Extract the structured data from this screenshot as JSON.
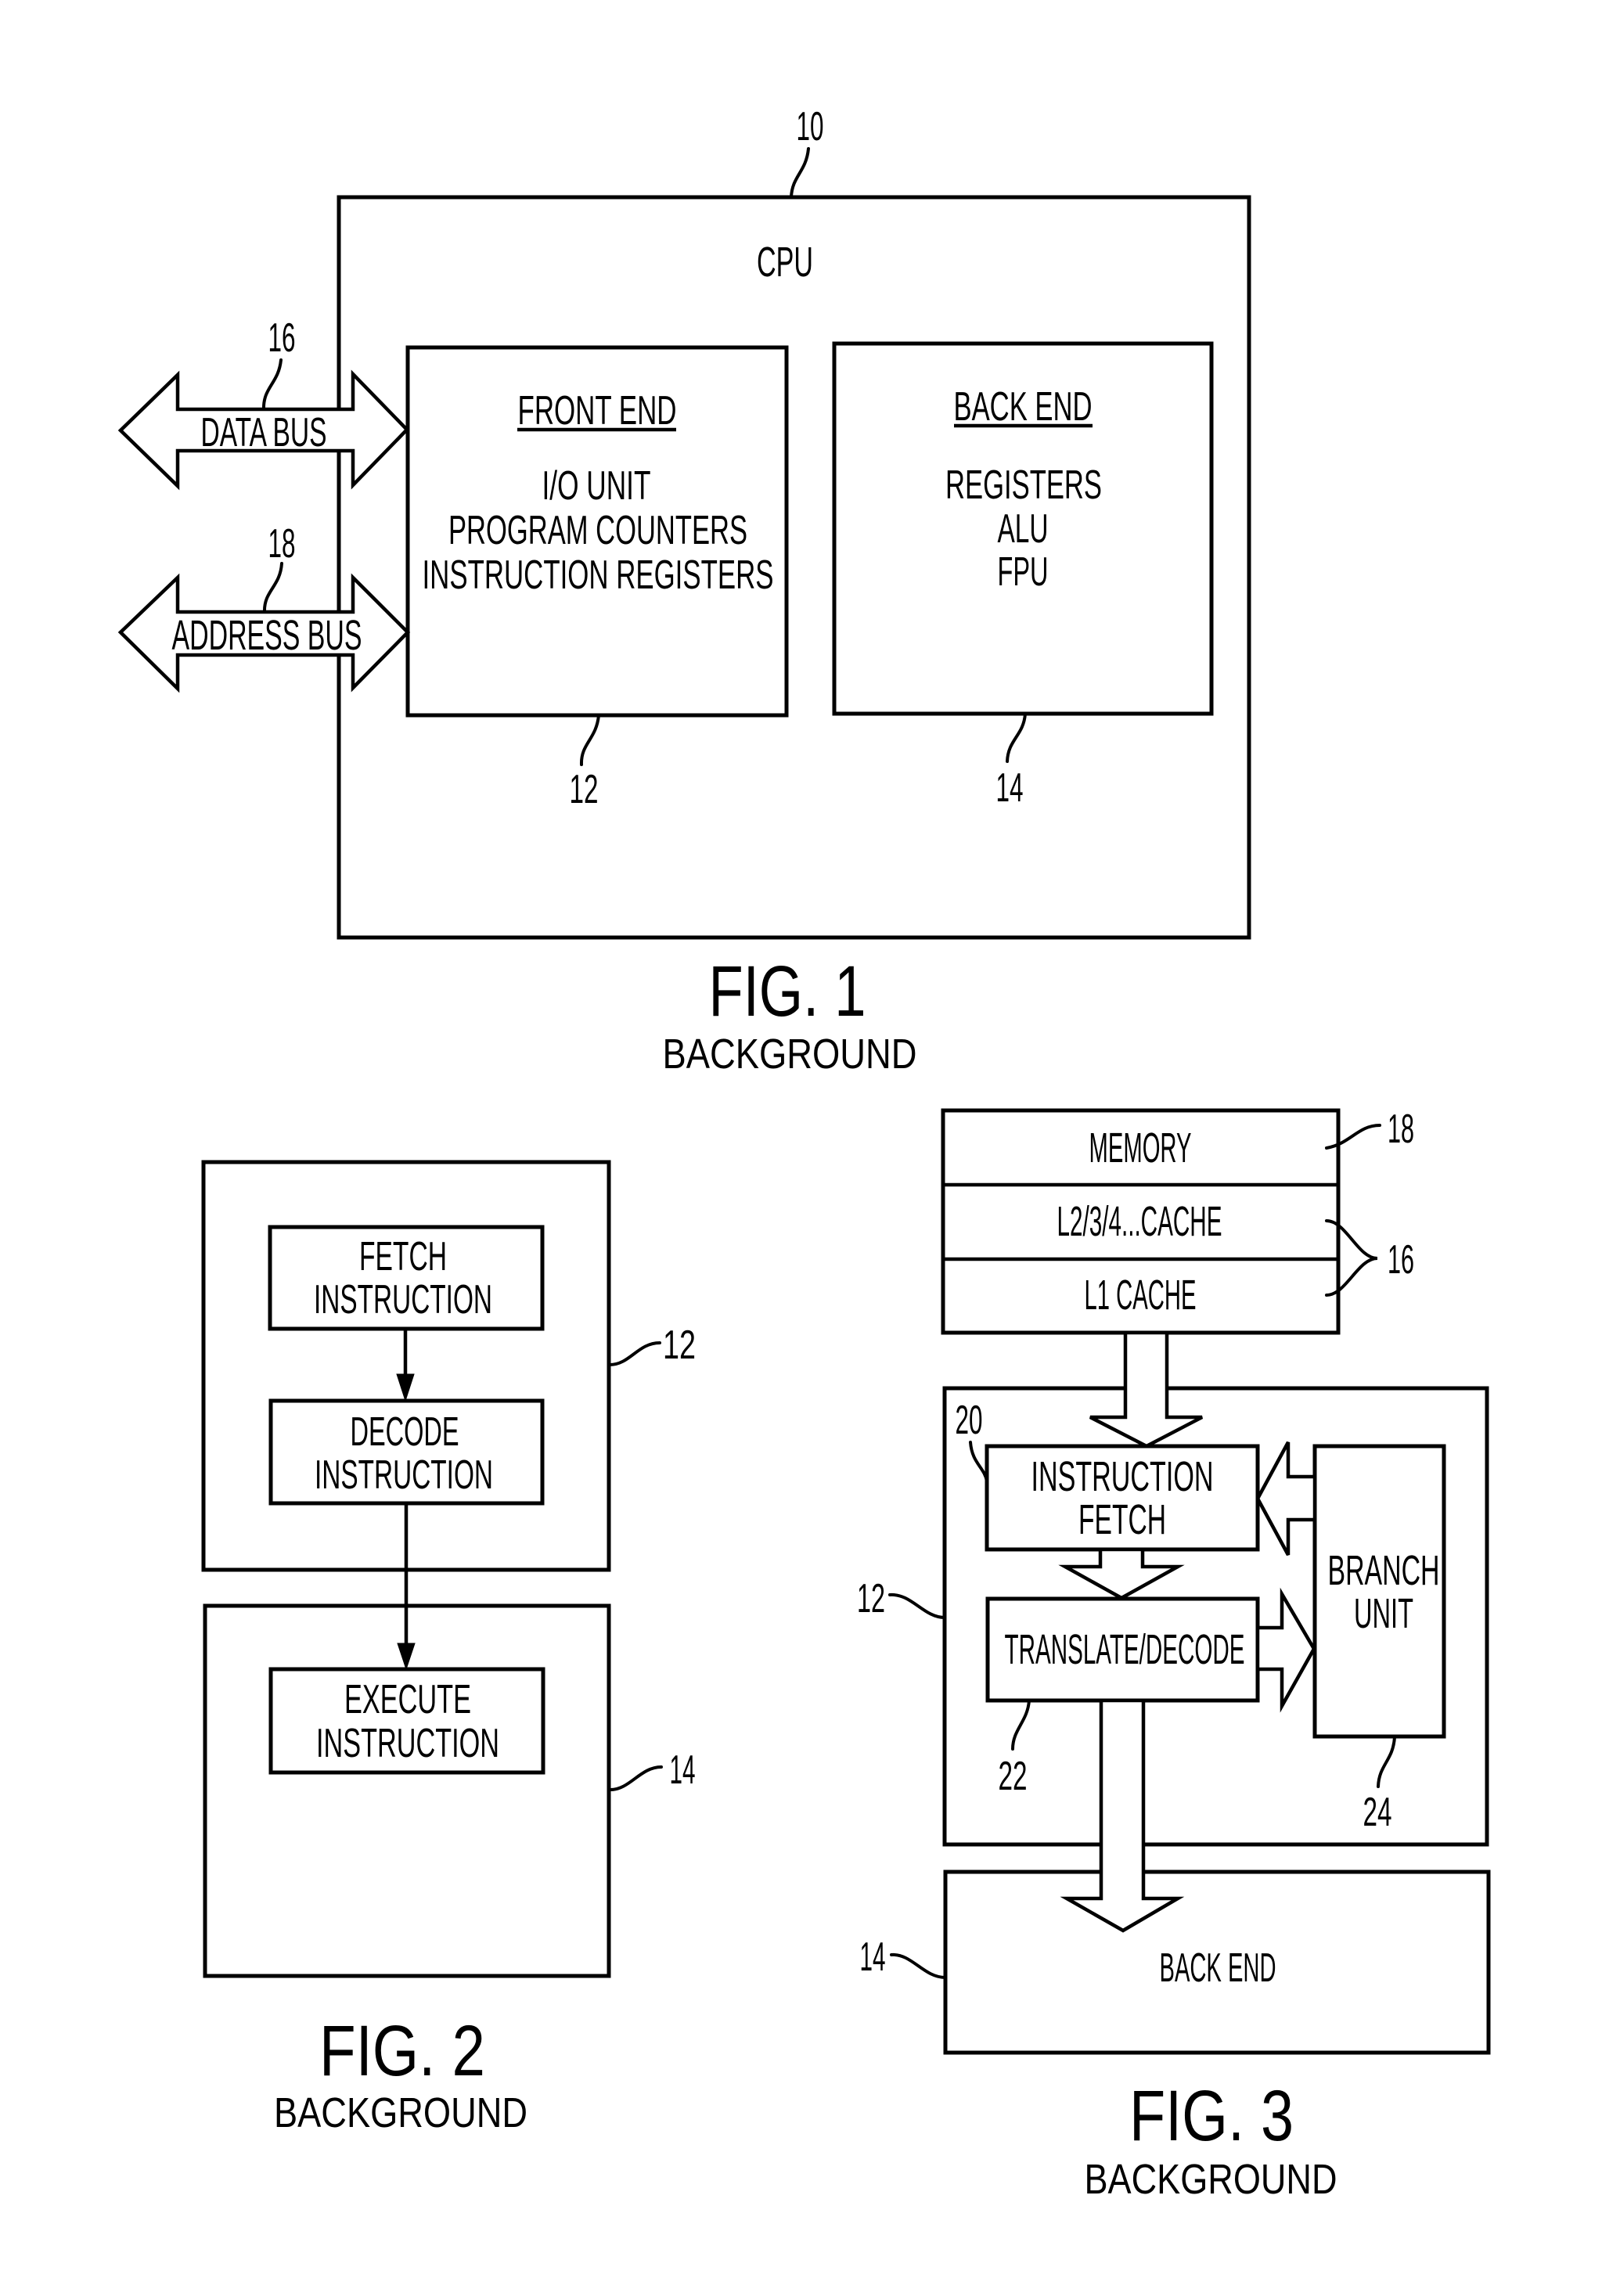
{
  "document": {
    "type": "patent drawing sheet",
    "figures_count": 3
  },
  "fig1": {
    "ref_cpu": "10",
    "cpu_label": "CPU",
    "data_bus": {
      "ref": "16",
      "label": "DATA BUS"
    },
    "address_bus": {
      "ref": "18",
      "label": "ADDRESS BUS"
    },
    "front_end": {
      "ref": "12",
      "title": "FRONT END",
      "lines": [
        "I/O UNIT",
        "PROGRAM COUNTERS",
        "INSTRUCTION REGISTERS"
      ]
    },
    "back_end": {
      "ref": "14",
      "title": "BACK END",
      "lines": [
        "REGISTERS",
        "ALU",
        "FPU"
      ]
    },
    "caption": "FIG. 1",
    "subcaption": "BACKGROUND"
  },
  "fig2": {
    "front_end_ref": "12",
    "back_end_ref": "14",
    "steps": [
      {
        "line1": "FETCH",
        "line2": "INSTRUCTION"
      },
      {
        "line1": "DECODE",
        "line2": "INSTRUCTION"
      },
      {
        "line1": "EXECUTE",
        "line2": "INSTRUCTION"
      }
    ],
    "caption": "FIG. 2",
    "subcaption": "BACKGROUND"
  },
  "fig3": {
    "memory_stack": {
      "rows": [
        "MEMORY",
        "L2/3/4...CACHE",
        "L1 CACHE"
      ],
      "memory_ref": "18",
      "cache_ref": "16"
    },
    "front_end_ref": "12",
    "instruction_fetch": {
      "ref": "20",
      "line1": "INSTRUCTION",
      "line2": "FETCH"
    },
    "translate_decode": {
      "ref": "22",
      "label": "TRANSLATE/DECODE"
    },
    "branch_unit": {
      "ref": "24",
      "line1": "BRANCH",
      "line2": "UNIT"
    },
    "back_end": {
      "ref": "14",
      "label": "BACK END"
    },
    "caption": "FIG. 3",
    "subcaption": "BACKGROUND"
  }
}
